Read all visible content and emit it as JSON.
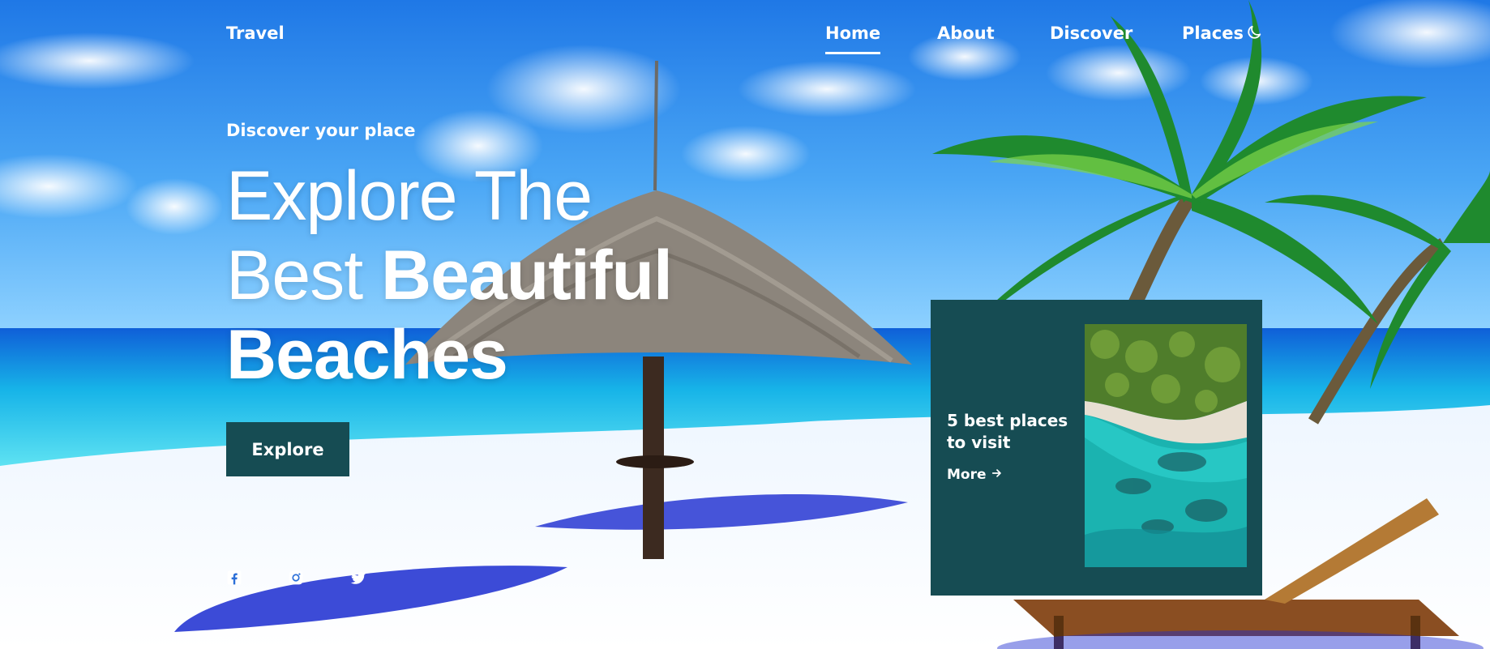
{
  "header": {
    "logo": "Travel",
    "nav": [
      {
        "label": "Home",
        "active": true
      },
      {
        "label": "About",
        "active": false
      },
      {
        "label": "Discover",
        "active": false
      },
      {
        "label": "Places",
        "active": false
      }
    ],
    "theme_icon": "moon-icon"
  },
  "hero": {
    "subtitle": "Discover your place",
    "title_light_1": "Explore The",
    "title_light_2": "Best ",
    "title_bold_1": "Beautiful",
    "title_bold_2": "Beaches",
    "button": "Explore"
  },
  "socials": [
    {
      "icon": "facebook-icon"
    },
    {
      "icon": "instagram-icon"
    },
    {
      "icon": "twitter-icon"
    }
  ],
  "card": {
    "title": "5 best places to visit",
    "more": "More",
    "more_icon": "arrow-right-icon"
  },
  "colors": {
    "accent": "#164c53",
    "sky": "#2b8fe8",
    "sea": "#16b9e3",
    "sand": "#f4f8ff"
  }
}
